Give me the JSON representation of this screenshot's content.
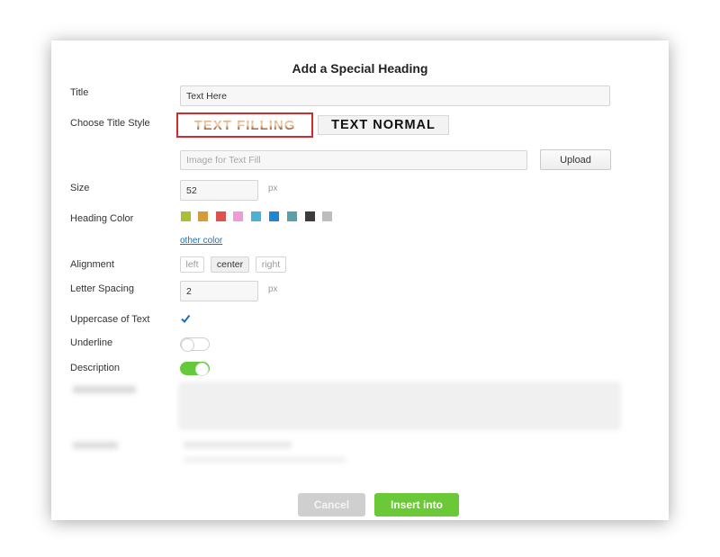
{
  "dialog": {
    "title": "Add a Special Heading"
  },
  "form": {
    "title_label": "Title",
    "title_value": "Text Here",
    "style_label": "Choose Title Style",
    "style_fill": "TEXT FILLING",
    "style_normal": "TEXT NORMAL",
    "image_placeholder": "Image for Text Fill",
    "upload_label": "Upload",
    "size_label": "Size",
    "size_value": "52",
    "size_unit": "px",
    "color_label": "Heading Color",
    "colors": [
      "#a8bf36",
      "#d69a3a",
      "#df5050",
      "#f29ad8",
      "#4bb2d4",
      "#1f86d1",
      "#5aa0a8",
      "#3f3b3b",
      "#bdbdbd"
    ],
    "other_color": "other color",
    "alignment_label": "Alignment",
    "align_options": [
      "left",
      "center",
      "right"
    ],
    "align_selected": "center",
    "spacing_label": "Letter Spacing",
    "spacing_value": "2",
    "spacing_unit": "px",
    "uppercase_label": "Uppercase of Text",
    "uppercase_checked": true,
    "underline_label": "Underline",
    "underline_on": false,
    "description_label": "Description",
    "description_on": true
  },
  "footer": {
    "cancel": "Cancel",
    "insert": "Insert into"
  },
  "colors": {
    "accent_green": "#6bc837",
    "selected_border": "#cf2d2d",
    "link": "#1f6fb5"
  }
}
